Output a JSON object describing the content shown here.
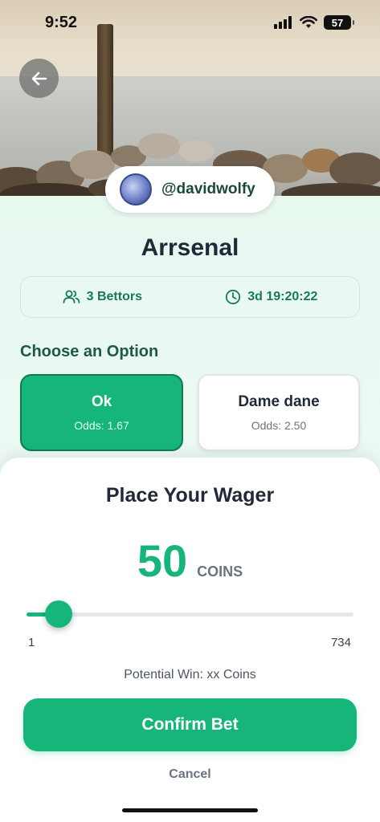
{
  "status_bar": {
    "time": "9:52",
    "battery": "57"
  },
  "header": {
    "username": "@davidwolfy"
  },
  "event": {
    "title": "Arrsenal",
    "bettors": "3 Bettors",
    "time_left": "3d 19:20:22"
  },
  "options": {
    "heading": "Choose an Option",
    "items": [
      {
        "name": "Ok",
        "odds": "Odds: 1.67"
      },
      {
        "name": "Dame dane",
        "odds": "Odds: 2.50"
      }
    ]
  },
  "wager": {
    "title": "Place Your Wager",
    "amount": "50",
    "unit": "COINS",
    "min": "1",
    "max": "734",
    "potential_win": "Potential Win: xx Coins",
    "confirm_label": "Confirm Bet",
    "cancel_label": "Cancel"
  },
  "colors": {
    "accent": "#16b67b",
    "accent_dark": "#0f7a52",
    "text_dark": "#1f2937"
  }
}
